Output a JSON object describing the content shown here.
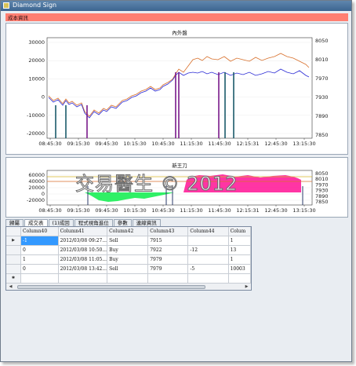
{
  "window": {
    "title": "Diamond Sign"
  },
  "bar_label": "成本資訊",
  "charts": [
    {
      "title": "內外盤",
      "x_ticks": [
        "08:45:30",
        "09:15:30",
        "09:45:30",
        "10:15:30",
        "10:45:30",
        "11:15:30",
        "11:45:30",
        "12:15:31",
        "12:45:30",
        "13:15:30"
      ],
      "y_left_ticks": [
        "30000",
        "20000",
        "10000",
        "0",
        "-10000",
        "-20000"
      ],
      "y_right_ticks": [
        "8050",
        "8010",
        "7970",
        "7930",
        "7890",
        "7850"
      ],
      "colors": {
        "blue": "#2a2ad4",
        "orange": "#d8702c",
        "purple": "#7a1a8a",
        "teal": "#1a5a6a"
      }
    },
    {
      "title": "新王刀",
      "x_ticks": [
        "08:45:30",
        "09:15:30",
        "09:45:30",
        "10:15:30",
        "10:45:30",
        "11:15:30",
        "11:45:30",
        "12:15:31",
        "12:45:30",
        "13:15:30"
      ],
      "y_left_ticks": [
        "60000",
        "40000",
        "20000",
        "0",
        "-20000"
      ],
      "y_right_ticks": [
        "8050",
        "8010",
        "7970",
        "7930",
        "7890",
        "7850"
      ],
      "colors": {
        "pink": "#ff1f9a",
        "green": "#19ee55"
      }
    }
  ],
  "watermark": "交易醫生 © 2012",
  "tabs": [
    "歸屬",
    "成交表",
    "(1)成回",
    "程式視角進位",
    "參數",
    "連線資訊"
  ],
  "table": {
    "columns": [
      "Column40",
      "Column41",
      "Column42",
      "Column43",
      "Column44",
      "Colum"
    ],
    "rows": [
      [
        "-1",
        "2012/03/08 09:27...",
        "Sell",
        "7915",
        "",
        "1"
      ],
      [
        "0",
        "2012/03/08 10:50...",
        "Buy",
        "7922",
        "-12",
        "13"
      ],
      [
        "1",
        "2012/03/08 11:05...",
        "Buy",
        "7979",
        "",
        "1"
      ],
      [
        "0",
        "2012/03/08 13:42...",
        "Sell",
        "7979",
        "-5",
        "10003"
      ],
      [
        "",
        "",
        "",
        "",
        "",
        ""
      ]
    ]
  }
}
